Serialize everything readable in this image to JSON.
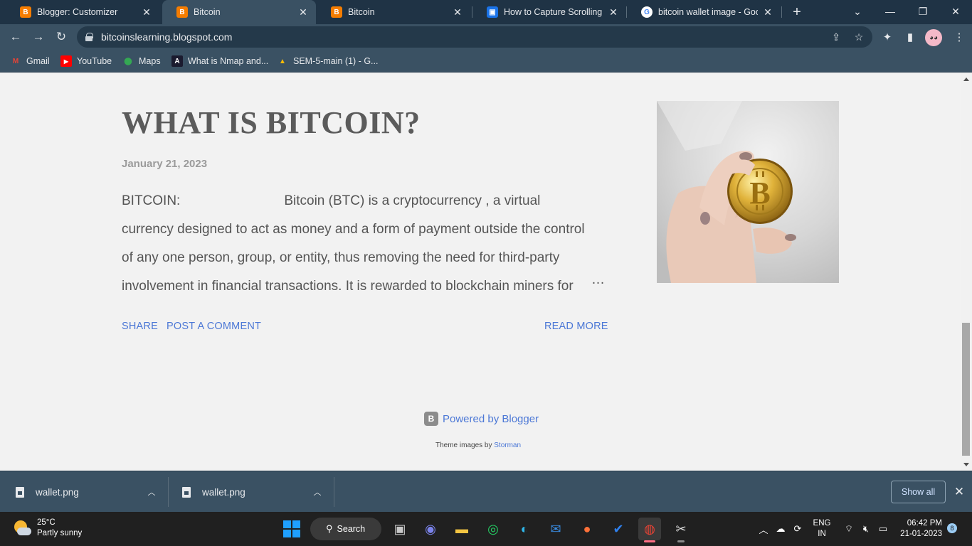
{
  "browser": {
    "tabs": [
      {
        "title": "Blogger: Customizer",
        "favicon": "blogger-icon",
        "active": false
      },
      {
        "title": "Bitcoin",
        "favicon": "blogger-icon",
        "active": true
      },
      {
        "title": "Bitcoin",
        "favicon": "blogger-icon",
        "active": false
      },
      {
        "title": "How to Capture Scrolling Scr",
        "favicon": "capture-icon",
        "active": false
      },
      {
        "title": "bitcoin wallet image - Googl",
        "favicon": "google-icon",
        "active": false
      }
    ],
    "url": "bitcoinslearning.blogspot.com",
    "bookmarks": [
      "Gmail",
      "YouTube",
      "Maps",
      "What is Nmap and...",
      "SEM-5-main (1) - G..."
    ]
  },
  "post": {
    "title": "WHAT IS BITCOIN?",
    "date": "January 21, 2023",
    "snippet_label": "BITCOIN:",
    "snippet_lines": [
      "Bitcoin (BTC) is a  cryptocurrency , a virtual",
      "currency designed to act as money and a form of payment outside the control",
      "of any one person, group, or entity, thus removing the need for third-party",
      "involvement in financial transactions. It is rewarded to blockchain miners for"
    ],
    "ellipsis": "…",
    "share_label": "SHARE",
    "comment_label": "POST A COMMENT",
    "read_more_label": "READ MORE",
    "image_alt": "Hand holding a gold bitcoin"
  },
  "footer": {
    "powered_by": "Powered by Blogger",
    "theme_prefix": "Theme images by ",
    "theme_author": "Storman"
  },
  "downloads": {
    "items": [
      "wallet.png",
      "wallet.png"
    ],
    "show_all": "Show all"
  },
  "taskbar": {
    "temperature": "25°C",
    "weather": "Partly sunny",
    "search_label": "Search",
    "lang_top": "ENG",
    "lang_bottom": "IN",
    "time": "06:42 PM",
    "date": "21-01-2023",
    "notification_count": "8"
  }
}
